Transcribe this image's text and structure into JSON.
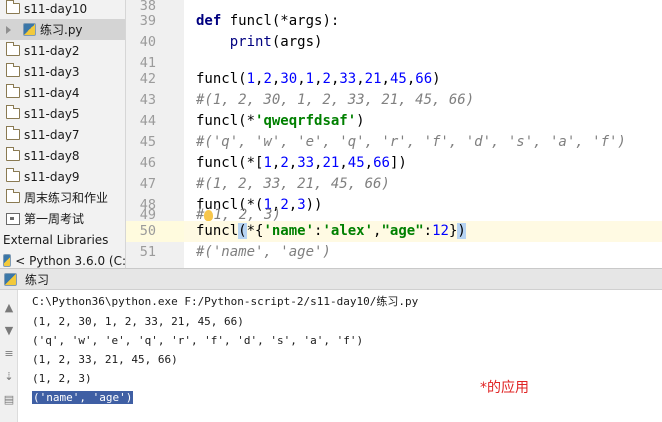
{
  "sidebar": {
    "items": [
      {
        "label": "s11-day10",
        "icon": "folder-icon"
      },
      {
        "label": "练习.py",
        "icon": "python-file-icon"
      },
      {
        "label": "s11-day2",
        "icon": "folder-icon"
      },
      {
        "label": "s11-day3",
        "icon": "folder-icon"
      },
      {
        "label": "s11-day4",
        "icon": "folder-icon"
      },
      {
        "label": "s11-day5",
        "icon": "folder-icon"
      },
      {
        "label": "s11-day7",
        "icon": "folder-icon"
      },
      {
        "label": "s11-day8",
        "icon": "folder-icon"
      },
      {
        "label": "s11-day9",
        "icon": "folder-icon"
      },
      {
        "label": "周末练习和作业",
        "icon": "folder-icon"
      },
      {
        "label": "第一周考试",
        "icon": "package-icon"
      },
      {
        "label": "External Libraries",
        "icon": ""
      },
      {
        "label": "< Python 3.6.0 (C:",
        "icon": "python-sdk-icon"
      }
    ]
  },
  "editor": {
    "line_numbers": [
      "38",
      "39",
      "40",
      "41",
      "42",
      "43",
      "44",
      "45",
      "46",
      "47",
      "48",
      "49",
      "50",
      "51"
    ],
    "caret_line": "50",
    "lines": {
      "l39_kw": "def",
      "l39_rest": " funcl(*args):",
      "l40_fn": "    print",
      "l40_rest": "(args)",
      "l42_a": "funcl(",
      "l42_n": [
        "1",
        "2",
        "30",
        "1",
        "2",
        "33",
        "21",
        "45",
        "66"
      ],
      "l43": "#(1, 2, 30, 1, 2, 33, 21, 45, 66)",
      "l44_a": "funcl(*",
      "l44_s": "'qweqrfdsaf'",
      "l44_b": ")",
      "l45": "#('q', 'w', 'e', 'q', 'r', 'f', 'd', 's', 'a', 'f')",
      "l46_a": "funcl(*[",
      "l46_n": [
        "1",
        "2",
        "33",
        "21",
        "45",
        "66"
      ],
      "l46_b": "])",
      "l47": "#(1, 2, 33, 21, 45, 66)",
      "l48_a": "funcl(*(",
      "l48_n": [
        "1",
        "2",
        "3"
      ],
      "l48_b": "))",
      "l49_a": "#",
      "l49_b": "1, 2, 3)",
      "l50_a": "funcl",
      "l50_paren_open": "(",
      "l50_b": "*{",
      "l50_k1": "'name'",
      "l50_colon1": ":",
      "l50_v1": "'alex'",
      "l50_comma": ",",
      "l50_k2": "\"age\"",
      "l50_colon2": ":",
      "l50_v2": "12",
      "l50_c": "}",
      "l50_paren_close": ")",
      "l51": "#('name', 'age')"
    }
  },
  "run_panel": {
    "title": "练习",
    "output": [
      "C:\\Python36\\python.exe F:/Python-script-2/s11-day10/练习.py",
      "(1, 2, 30, 1, 2, 33, 21, 45, 66)",
      "('q', 'w', 'e', 'q', 'r', 'f', 'd', 's', 'a', 'f')",
      "(1, 2, 33, 21, 45, 66)",
      "(1, 2, 3)",
      "('name', 'age')"
    ]
  },
  "annotation": "*的应用",
  "colors": {
    "keyword": "#000080",
    "number": "#0000ff",
    "string": "#008000",
    "comment": "#808080",
    "annotation": "#e02424",
    "selection": "#3f5fa4"
  }
}
